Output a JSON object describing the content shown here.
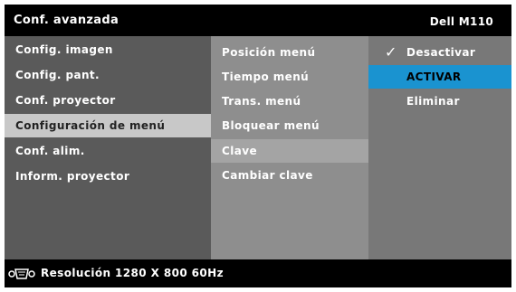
{
  "header": {
    "title": "Conf. avanzada",
    "model": "Dell  M110"
  },
  "menu": {
    "items": [
      {
        "label": "Config. imagen"
      },
      {
        "label": "Config. pant."
      },
      {
        "label": "Conf. proyector"
      },
      {
        "label": "Configuración de menú",
        "selected": true
      },
      {
        "label": "Conf. alim."
      },
      {
        "label": "Inform. proyector"
      }
    ]
  },
  "submenu": {
    "items": [
      {
        "label": "Posición menú"
      },
      {
        "label": "Tiempo menú"
      },
      {
        "label": "Trans. menú"
      },
      {
        "label": "Bloquear menú"
      },
      {
        "label": "Clave",
        "selected": true
      },
      {
        "label": "Cambiar clave"
      }
    ]
  },
  "options": {
    "items": [
      {
        "label": "Desactivar",
        "checked": true
      },
      {
        "label": "ACTIVAR",
        "highlighted": true
      },
      {
        "label": "Eliminar"
      }
    ],
    "check_glyph": "✓"
  },
  "status": {
    "icon": "video-connector-icon",
    "text": "Resolución   1280 X 800 60Hz"
  },
  "colors": {
    "highlight": "#1a93d0",
    "menu_bg": "#5a5a5a",
    "submenu_bg": "#8e8e8e",
    "options_bg": "#787878"
  }
}
